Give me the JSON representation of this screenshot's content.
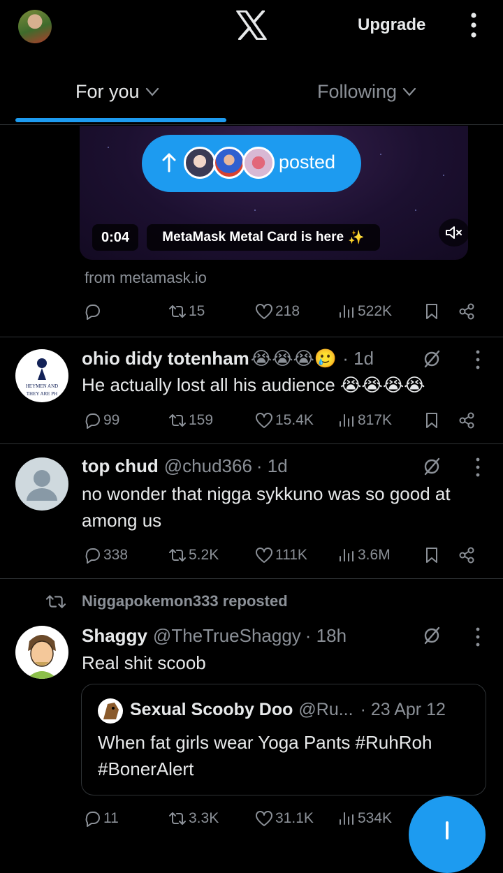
{
  "header": {
    "logo": "x-logo",
    "upgrade_label": "Upgrade"
  },
  "tabs": [
    {
      "label": "For you",
      "active": true
    },
    {
      "label": "Following",
      "active": false
    }
  ],
  "video_post": {
    "posted_label": "posted",
    "time": "0:04",
    "video_title": "MetaMask Metal Card is here",
    "video_title_emoji": "✨",
    "source": "from metamask.io",
    "stats": {
      "reposts": "15",
      "likes": "218",
      "views": "522K"
    }
  },
  "posts": [
    {
      "name": "ohio didy totenham",
      "name_emoji": "😭😭😭🥲",
      "handle": "",
      "time": "· 1d",
      "text": "He actually lost all his audience 😭😭😭😭",
      "avatar_text": "HEYMEN AND THEY ARE PH",
      "stats": {
        "replies": "99",
        "reposts": "159",
        "likes": "15.4K",
        "views": "817K"
      }
    },
    {
      "name": "top chud",
      "handle": "@chud366",
      "time": "· 1d",
      "text": "no wonder that nigga sykkuno was so good at among us",
      "stats": {
        "replies": "338",
        "reposts": "5.2K",
        "likes": "111K",
        "views": "3.6M"
      }
    },
    {
      "repost_label": "Niggapokemon333 reposted",
      "name": "Shaggy",
      "handle": "@TheTrueShaggy",
      "time": "· 18h",
      "text": "Real shit scoob",
      "quote": {
        "name": "Sexual Scooby Doo",
        "handle": "@Ru...",
        "time": "· 23 Apr 12",
        "text": "When fat girls wear Yoga Pants #RuhRoh #BonerAlert"
      },
      "stats": {
        "replies": "11",
        "reposts": "3.3K",
        "likes": "31.1K",
        "views": "534K"
      }
    }
  ],
  "colors": {
    "accent": "#1d9bf0",
    "background": "#000000",
    "muted": "#8b9097",
    "text": "#e7e9ea"
  }
}
